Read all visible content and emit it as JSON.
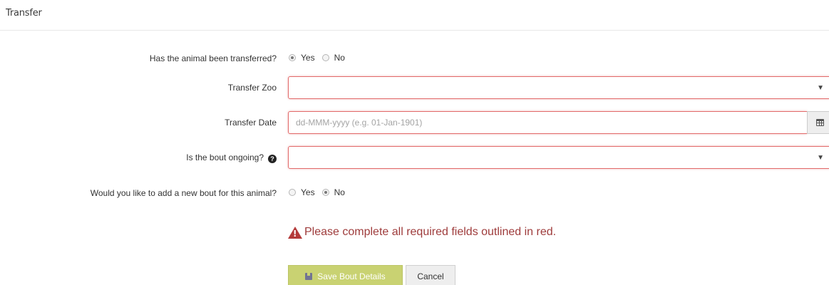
{
  "section": {
    "title": "Transfer"
  },
  "fields": {
    "transferred": {
      "label": "Has the animal been transferred?",
      "options": [
        "Yes",
        "No"
      ],
      "selected": "Yes"
    },
    "transfer_zoo": {
      "label": "Transfer Zoo",
      "value": ""
    },
    "transfer_date": {
      "label": "Transfer Date",
      "value": "",
      "placeholder": "dd-MMM-yyyy (e.g. 01-Jan-1901)"
    },
    "bout_ongoing": {
      "label": "Is the bout ongoing?",
      "value": ""
    },
    "new_bout": {
      "label": "Would you like to add a new bout for this animal?",
      "options": [
        "Yes",
        "No"
      ],
      "selected": "No"
    }
  },
  "alert": {
    "message": "Please complete all required fields outlined in red."
  },
  "buttons": {
    "save": "Save Bout Details",
    "cancel": "Cancel"
  },
  "colors": {
    "required_border": "#e26a6a",
    "save_button": "#c7d06b",
    "alert_text": "#9e3b3b"
  }
}
